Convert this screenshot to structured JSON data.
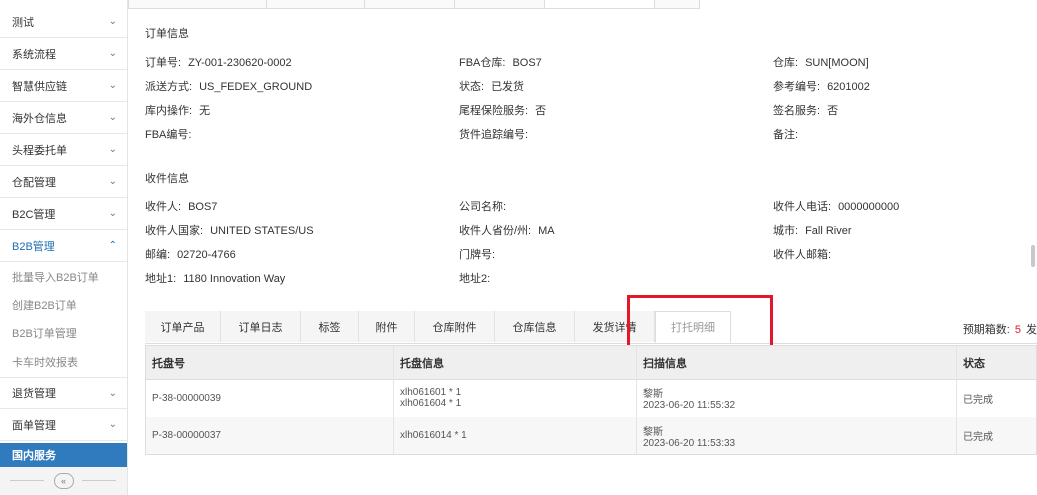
{
  "sidebar": {
    "items": [
      {
        "label": "测试"
      },
      {
        "label": "系统流程"
      },
      {
        "label": "智慧供应链"
      },
      {
        "label": "海外仓信息"
      },
      {
        "label": "头程委托单"
      },
      {
        "label": "仓配管理"
      },
      {
        "label": "B2C管理"
      },
      {
        "label": "B2B管理"
      }
    ],
    "b2b_subitems": [
      "批量导入B2B订单",
      "创建B2B订单",
      "B2B订单管理",
      "卡车时效报表"
    ],
    "items_after": [
      {
        "label": "退货管理"
      },
      {
        "label": "面单管理"
      }
    ],
    "domestic": "国内服务",
    "collapse_icon": "«"
  },
  "order_info": {
    "title": "订单信息",
    "order_no_label": "订单号:",
    "order_no": "ZY-001-230620-0002",
    "fba_wh_label": "FBA仓库:",
    "fba_wh": "BOS7",
    "warehouse_label": "仓库:",
    "warehouse": "SUN[MOON]",
    "ship_method_label": "派送方式:",
    "ship_method": "US_FEDEX_GROUND",
    "status_label": "状态:",
    "status": "已发货",
    "ref_no_label": "参考编号:",
    "ref_no": "6201002",
    "inwh_op_label": "库内操作:",
    "inwh_op": "无",
    "tail_ins_label": "尾程保险服务:",
    "tail_ins": "否",
    "sign_service_label": "签名服务:",
    "sign_service": "否",
    "fba_no_label": "FBA编号:",
    "tracking_label": "货件追踪编号:",
    "remark_label": "备注:"
  },
  "recipient_info": {
    "title": "收件信息",
    "name_label": "收件人:",
    "name": "BOS7",
    "company_label": "公司名称:",
    "phone_label": "收件人电话:",
    "phone": "0000000000",
    "country_label": "收件人国家:",
    "country": "UNITED STATES/US",
    "state_label": "收件人省份/州:",
    "state": "MA",
    "city_label": "城市:",
    "city": "Fall River",
    "zip_label": "邮编:",
    "zip": "02720-4766",
    "door_label": "门牌号:",
    "email_label": "收件人邮箱:",
    "addr1_label": "地址1:",
    "addr1": "1180 Innovation Way",
    "addr2_label": "地址2:"
  },
  "tabs": [
    {
      "label": "订单产品"
    },
    {
      "label": "订单日志"
    },
    {
      "label": "标签"
    },
    {
      "label": "附件"
    },
    {
      "label": "仓库附件"
    },
    {
      "label": "仓库信息"
    },
    {
      "label": "发货详情"
    },
    {
      "label": "打托明细"
    }
  ],
  "box_count": {
    "label": "预期箱数:",
    "value": "5",
    "tail": "发"
  },
  "table": {
    "headers": [
      "托盘号",
      "托盘信息",
      "扫描信息",
      "状态"
    ],
    "rows": [
      {
        "pallet_no": "P-38-00000039",
        "info1": "xlh061601 * 1",
        "info2": "xlh061604 * 1",
        "scanner": "黎斯",
        "scan_time": "2023-06-20 11:55:32",
        "status": "已完成"
      },
      {
        "pallet_no": "P-38-00000037",
        "info1": "xlh0616014 * 1",
        "info2": "",
        "scanner": "黎斯",
        "scan_time": "2023-06-20 11:53:33",
        "status": "已完成"
      }
    ]
  },
  "colors": {
    "accent": "#2f7bbd",
    "highlight": "#e5162a"
  }
}
